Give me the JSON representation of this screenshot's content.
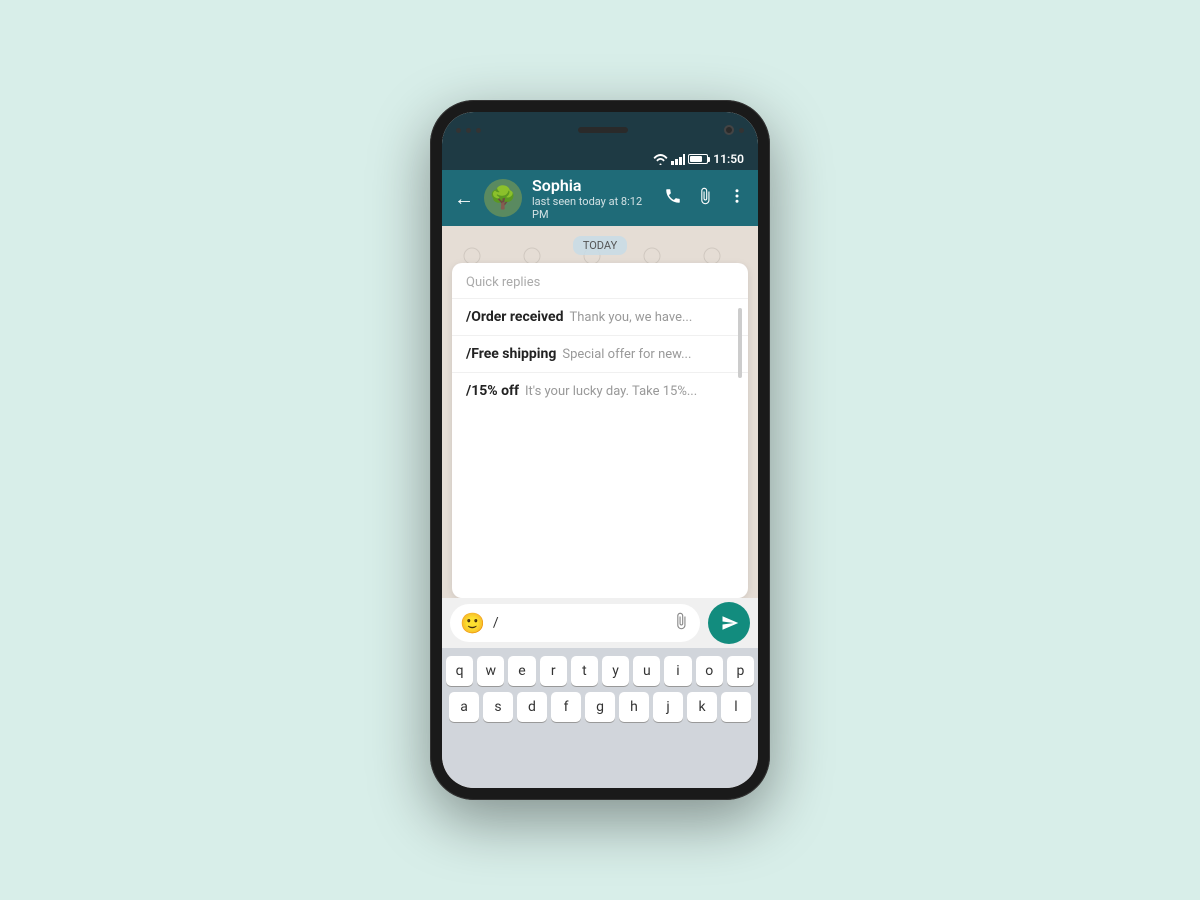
{
  "phone": {
    "status_bar": {
      "time": "11:50"
    },
    "chat_header": {
      "back_label": "←",
      "contact_name": "Sophia",
      "contact_status": "last seen today at 8:12 PM",
      "avatar_emoji": "🌳",
      "call_icon": "call",
      "attach_icon": "attach",
      "more_icon": "more"
    },
    "date_badge": "TODAY",
    "quick_replies": {
      "title": "Quick replies",
      "items": [
        {
          "shortcut": "/Order received",
          "preview": "Thank you, we have..."
        },
        {
          "shortcut": "/Free shipping",
          "preview": "Special offer for new..."
        },
        {
          "shortcut": "/15% off",
          "preview": "It's your lucky day. Take 15%..."
        }
      ]
    },
    "input_bar": {
      "text_value": "/",
      "send_icon": "send"
    },
    "keyboard": {
      "rows": [
        [
          "q",
          "w",
          "e",
          "r",
          "t",
          "y",
          "u",
          "i",
          "o",
          "p"
        ],
        [
          "a",
          "s",
          "d",
          "f",
          "g",
          "h",
          "j",
          "k",
          "l"
        ]
      ]
    }
  }
}
